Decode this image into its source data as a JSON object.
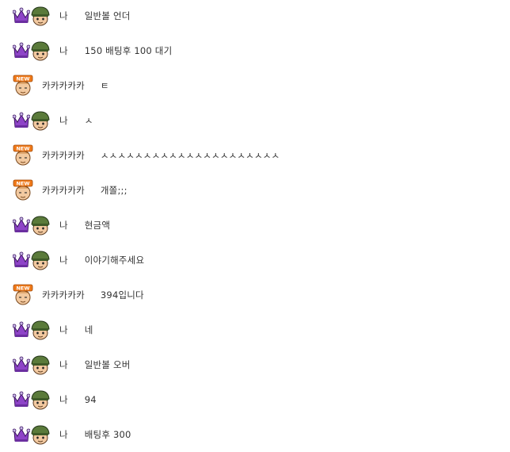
{
  "chat": {
    "messages": [
      {
        "sender": "나",
        "type": "me",
        "text": "일반볼 언더"
      },
      {
        "sender": "나",
        "type": "me",
        "text": "150 배팅후 100 대기"
      },
      {
        "sender": "카카카카카",
        "type": "other",
        "text": "ㅌ"
      },
      {
        "sender": "나",
        "type": "me",
        "text": "ㅅ"
      },
      {
        "sender": "카카카카카",
        "type": "other",
        "text": "ㅅㅅㅅㅅㅅㅅㅅㅅㅅㅅㅅㅅㅅㅅㅅㅅㅅㅅㅅㅅㅅ"
      },
      {
        "sender": "카카카카카",
        "type": "other",
        "text": "개쫄;;;"
      },
      {
        "sender": "나",
        "type": "me",
        "text": "현금액"
      },
      {
        "sender": "나",
        "type": "me",
        "text": "이야기해주세요"
      },
      {
        "sender": "카카카카카",
        "type": "other",
        "text": "394입니다"
      },
      {
        "sender": "나",
        "type": "me",
        "text": "네"
      },
      {
        "sender": "나",
        "type": "me",
        "text": "일반볼 오버"
      },
      {
        "sender": "나",
        "type": "me",
        "text": "94"
      },
      {
        "sender": "나",
        "type": "me",
        "text": "배팅후 300"
      }
    ]
  },
  "icons": {
    "me": [
      "crown-icon",
      "soldier-avatar-icon"
    ],
    "other": [
      "new-badge-avatar-icon"
    ]
  },
  "badge_text": "NEW",
  "colors": {
    "crown": "#8e44c8",
    "helmet": "#5a7a3a",
    "skin": "#f2c9a0",
    "new_badge": "#f07a1a"
  }
}
